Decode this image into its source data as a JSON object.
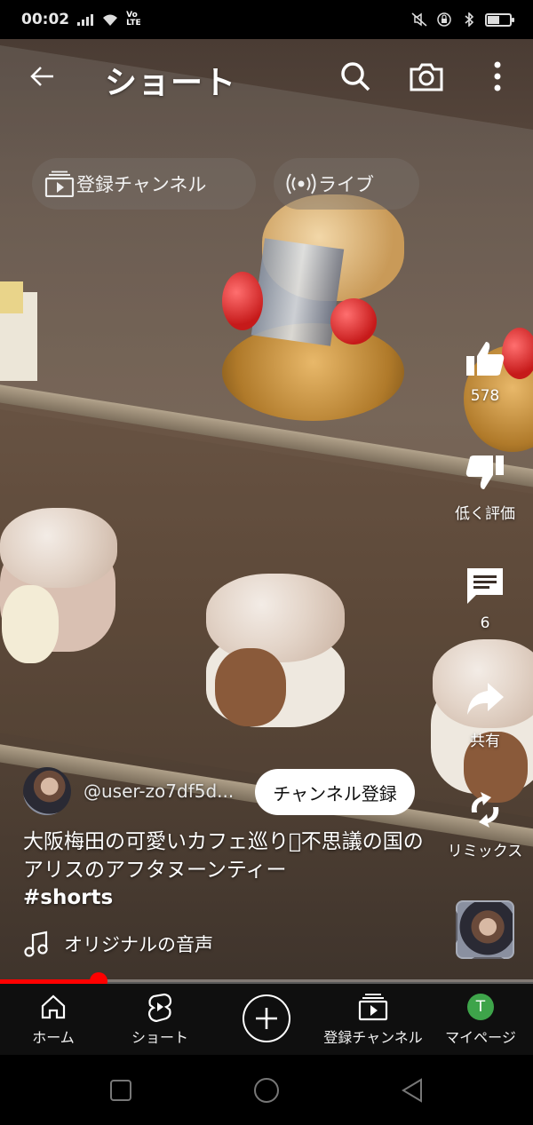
{
  "status_bar": {
    "time": "00:02",
    "icons": [
      "signal-icon",
      "wifi-icon",
      "volte-icon",
      "mute-icon",
      "lock-icon",
      "bluetooth-icon",
      "battery-icon"
    ],
    "volte_top": "Vo",
    "volte_bottom": "LTE",
    "battery_level": 0.55
  },
  "header": {
    "title": "ショート",
    "back_icon": "arrow-left-icon",
    "actions": [
      "search-icon",
      "camera-icon",
      "more-vert-icon"
    ]
  },
  "chips": [
    {
      "label": "登録チャンネル",
      "icon": "subscriptions-icon"
    },
    {
      "label": "ライブ",
      "icon": "live-icon"
    }
  ],
  "actions": {
    "like": {
      "label": "578",
      "icon": "thumb-up-icon"
    },
    "dislike": {
      "label": "低く評価",
      "icon": "thumb-down-icon"
    },
    "comments": {
      "label": "6",
      "icon": "comment-icon"
    },
    "share": {
      "label": "共有",
      "icon": "share-icon"
    },
    "remix": {
      "label": "リミックス",
      "icon": "remix-icon"
    }
  },
  "video": {
    "channel_handle": "@user-zo7df5d...",
    "subscribe_label": "チャンネル登録",
    "title": "大阪梅田の可愛いカフェ巡り􏿽不思議の国のアリスのアフタヌーンティー",
    "tag": "#shorts",
    "audio_label": "オリジナルの音声",
    "progress": 0.185
  },
  "bottom_nav": {
    "items": [
      {
        "label": "ホーム",
        "icon": "home-icon"
      },
      {
        "label": "ショート",
        "icon": "shorts-icon"
      },
      {
        "label": "",
        "icon": "create-icon"
      },
      {
        "label": "登録チャンネル",
        "icon": "subscriptions-icon"
      },
      {
        "label": "マイページ",
        "icon": "account-icon",
        "avatar_letter": "T"
      }
    ]
  },
  "colors": {
    "accent": "#ff0000",
    "account_avatar": "#3ea44a",
    "nav_background": "#0f0f0f"
  }
}
